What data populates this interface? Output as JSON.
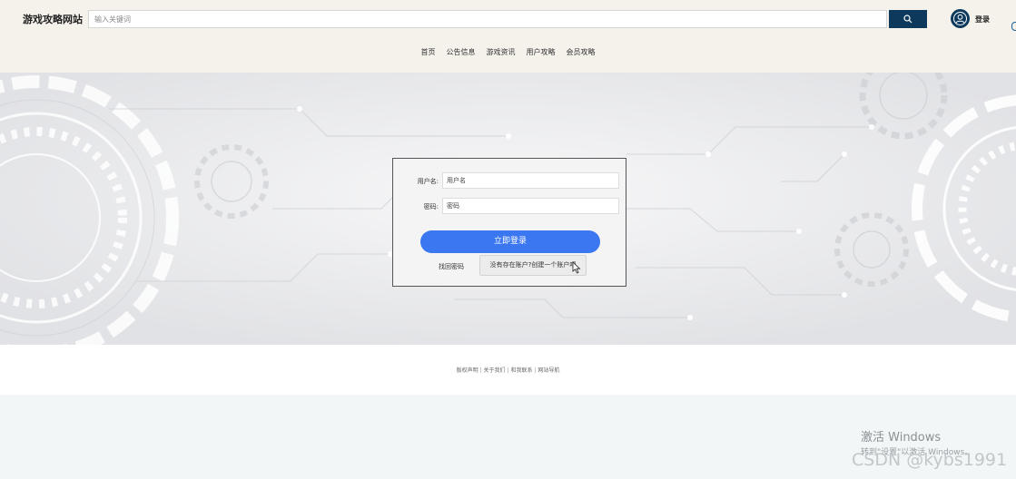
{
  "header": {
    "site_title": "游戏攻略网站",
    "search": {
      "placeholder": "输入关键词",
      "value": ""
    },
    "login_label": "登录"
  },
  "nav": {
    "items": [
      "首页",
      "公告信息",
      "游戏资讯",
      "用户攻略",
      "会员攻略"
    ]
  },
  "login_form": {
    "username_label": "用户名:",
    "username_placeholder": "用户名",
    "password_label": "密码:",
    "password_placeholder": "密码",
    "submit_label": "立即登录",
    "forgot_label": "找回密码",
    "register_label": "没有存在账户?创建一个账户吧"
  },
  "footer": {
    "links": [
      "版权声明",
      "关于我们",
      "和我联系",
      "网站导航"
    ],
    "separator": "|"
  },
  "watermarks": {
    "windows_title": "激活 Windows",
    "windows_sub": "转到\"设置\"以激活 Windows。",
    "csdn": "CSDN @kybs1991"
  },
  "colors": {
    "header_bg": "#f5f2ec",
    "accent_dark": "#0d3a5c",
    "primary_button": "#3a77f0",
    "page_bg": "#f3f6f7"
  },
  "icons": {
    "search_button": "search-icon",
    "avatar": "user-icon",
    "cursor": "mouse-cursor-icon"
  }
}
